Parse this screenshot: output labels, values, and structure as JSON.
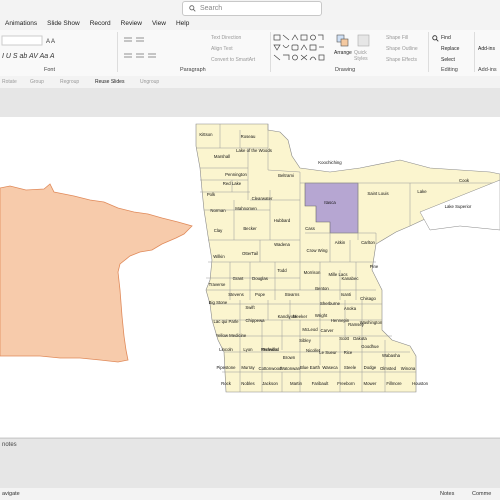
{
  "search": {
    "placeholder": "Search"
  },
  "menu": [
    "Animations",
    "Slide Show",
    "Record",
    "Review",
    "View",
    "Help"
  ],
  "ribbon": {
    "groups": {
      "font": "Font",
      "paragraph": "Paragraph",
      "drawing": "Drawing",
      "editing": "Editing",
      "addins": "Add-ins"
    },
    "paragraph_items": [
      "Text Direction",
      "Align Text",
      "Convert to SmartArt"
    ],
    "drawing_items": [
      "Arrange",
      "Quick Styles",
      "Shape Fill",
      "Shape Outline",
      "Shape Effects"
    ],
    "editing_items": [
      "Find",
      "Replace",
      "Select"
    ],
    "addins_label": "Add-ins"
  },
  "secondbar": [
    "Rotate",
    "Group",
    "Regroup",
    "Reuse Slides",
    "Ungroup"
  ],
  "notes_label": "notes",
  "status": {
    "left": "avigate",
    "notes": "Notes",
    "comments": "Comme"
  },
  "colors": {
    "county_fill": "#fbf5cf",
    "highlight": "#b6a6d2",
    "mn_fill": "#f7cbab"
  },
  "counties": [
    {
      "name": "Kittson"
    },
    {
      "name": "Roseau"
    },
    {
      "name": "Lake of the Woods"
    },
    {
      "name": "Marshall"
    },
    {
      "name": "Pennington"
    },
    {
      "name": "Red Lake"
    },
    {
      "name": "Polk"
    },
    {
      "name": "Beltrami"
    },
    {
      "name": "Koochiching"
    },
    {
      "name": "Itasca"
    },
    {
      "name": "Saint Louis"
    },
    {
      "name": "Lake"
    },
    {
      "name": "Cook"
    },
    {
      "name": "Lake Superior"
    },
    {
      "name": "Norman"
    },
    {
      "name": "Mahnomen"
    },
    {
      "name": "Clearwater"
    },
    {
      "name": "Hubbard"
    },
    {
      "name": "Cass"
    },
    {
      "name": "Clay"
    },
    {
      "name": "Becker"
    },
    {
      "name": "Wadena"
    },
    {
      "name": "Crow Wing"
    },
    {
      "name": "Aitkin"
    },
    {
      "name": "Carlton"
    },
    {
      "name": "Wilkin"
    },
    {
      "name": "OtterTail"
    },
    {
      "name": "Todd"
    },
    {
      "name": "Morrison"
    },
    {
      "name": "Mille Lacs"
    },
    {
      "name": "Kanabec"
    },
    {
      "name": "Pine"
    },
    {
      "name": "Traverse"
    },
    {
      "name": "Grant"
    },
    {
      "name": "Douglas"
    },
    {
      "name": "Stevens"
    },
    {
      "name": "Pope"
    },
    {
      "name": "Stearns"
    },
    {
      "name": "Benton"
    },
    {
      "name": "Isanti"
    },
    {
      "name": "Chisago"
    },
    {
      "name": "Big Stone"
    },
    {
      "name": "Swift"
    },
    {
      "name": "Sherburne"
    },
    {
      "name": "Anoka"
    },
    {
      "name": "Lac qui Parle"
    },
    {
      "name": "Chippewa"
    },
    {
      "name": "Kandiyohi"
    },
    {
      "name": "Meeker"
    },
    {
      "name": "Wright"
    },
    {
      "name": "Hennepin"
    },
    {
      "name": "Ramsey"
    },
    {
      "name": "Washington"
    },
    {
      "name": "Yellow Medicine"
    },
    {
      "name": "Renville"
    },
    {
      "name": "McLeod"
    },
    {
      "name": "Carver"
    },
    {
      "name": "Scott"
    },
    {
      "name": "Dakota"
    },
    {
      "name": "Lincoln"
    },
    {
      "name": "Lyon"
    },
    {
      "name": "Redwood"
    },
    {
      "name": "Brown"
    },
    {
      "name": "Sibley"
    },
    {
      "name": "Nicollet"
    },
    {
      "name": "Le Sueur"
    },
    {
      "name": "Rice"
    },
    {
      "name": "Goodhue"
    },
    {
      "name": "Wabasha"
    },
    {
      "name": "Pipestone"
    },
    {
      "name": "Murray"
    },
    {
      "name": "Cottonwood"
    },
    {
      "name": "Watonwan"
    },
    {
      "name": "Blue Earth"
    },
    {
      "name": "Waseca"
    },
    {
      "name": "Steele"
    },
    {
      "name": "Dodge"
    },
    {
      "name": "Olmsted"
    },
    {
      "name": "Winona"
    },
    {
      "name": "Rock"
    },
    {
      "name": "Nobles"
    },
    {
      "name": "Jackson"
    },
    {
      "name": "Martin"
    },
    {
      "name": "Faribault"
    },
    {
      "name": "Freeborn"
    },
    {
      "name": "Mower"
    },
    {
      "name": "Fillmore"
    },
    {
      "name": "Houston"
    }
  ]
}
